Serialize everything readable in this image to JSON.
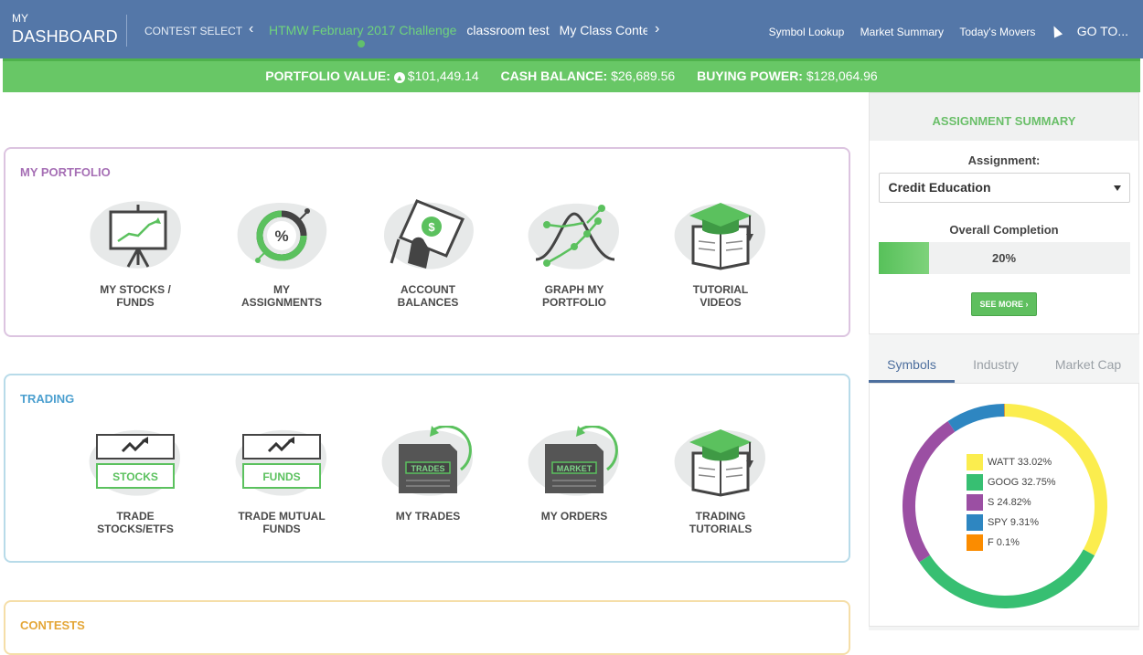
{
  "header": {
    "brand_small": "MY",
    "brand_big": "DASHBOARD",
    "contest_select": "CONTEST SELECT",
    "prev_arrow": "‹",
    "next_arrow": "›",
    "contests": [
      {
        "label": "HTMW February 2017 Challenge",
        "active": true
      },
      {
        "label": "classroom test",
        "active": false
      },
      {
        "label": "My Class Contest",
        "active": false
      }
    ],
    "links": {
      "symbol_lookup": "Symbol Lookup",
      "market_summary": "Market Summary",
      "todays_movers": "Today's Movers",
      "goto": "GO TO..."
    }
  },
  "summary": {
    "portfolio_label": "PORTFOLIO VALUE:",
    "portfolio_value": "$101,449.14",
    "cash_label": "CASH BALANCE:",
    "cash_value": "$26,689.56",
    "buying_label": "BUYING POWER:",
    "buying_value": "$128,064.96"
  },
  "portfolio": {
    "title": "MY PORTFOLIO",
    "tiles": [
      {
        "line1": "MY STOCKS /",
        "line2": "FUNDS",
        "icon": "presentation-chart-icon"
      },
      {
        "line1": "MY",
        "line2": "ASSIGNMENTS",
        "icon": "percent-donut-icon"
      },
      {
        "line1": "ACCOUNT",
        "line2": "BALANCES",
        "icon": "money-hand-icon"
      },
      {
        "line1": "GRAPH MY",
        "line2": "PORTFOLIO",
        "icon": "graph-curve-icon"
      },
      {
        "line1": "TUTORIAL",
        "line2": "VIDEOS",
        "icon": "graduation-book-icon"
      }
    ]
  },
  "trading": {
    "title": "TRADING",
    "stocks_badge": "STOCKS",
    "funds_badge": "FUNDS",
    "trades_badge": "TRADES",
    "market_badge": "MARKET",
    "tiles": [
      {
        "line1": "TRADE",
        "line2": "STOCKS/ETFS",
        "icon": "trade-stocks-icon"
      },
      {
        "line1": "TRADE MUTUAL",
        "line2": "FUNDS",
        "icon": "trade-funds-icon"
      },
      {
        "line1": "MY TRADES",
        "line2": "",
        "icon": "trades-document-icon"
      },
      {
        "line1": "MY ORDERS",
        "line2": "",
        "icon": "orders-document-icon"
      },
      {
        "line1": "TRADING",
        "line2": "TUTORIALS",
        "icon": "graduation-book-icon"
      }
    ]
  },
  "contests_card": {
    "title": "CONTESTS"
  },
  "assignment": {
    "header": "ASSIGNMENT SUMMARY",
    "label": "Assignment:",
    "selected": "Credit Education",
    "completion_label": "Overall Completion",
    "completion": 0.2,
    "completion_text": "20%",
    "see_more": "SEE MORE ›"
  },
  "allocation": {
    "tabs": [
      "Symbols",
      "Industry",
      "Market Cap"
    ],
    "active_tab": 0
  },
  "chart_data": {
    "type": "pie",
    "donut": true,
    "categories": [
      "WATT",
      "GOOG",
      "S",
      "SPY",
      "F"
    ],
    "values": [
      33.02,
      32.75,
      24.82,
      9.31,
      0.1
    ],
    "labels": [
      "WATT 33.02%",
      "GOOG 32.75%",
      "S 24.82%",
      "SPY 9.31%",
      "F 0.1%"
    ],
    "colors": [
      "#fbed4e",
      "#37bf72",
      "#9b4fa3",
      "#2e86c1",
      "#fb8c00"
    ],
    "legend": "center"
  }
}
